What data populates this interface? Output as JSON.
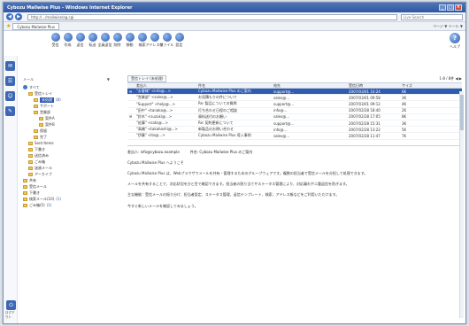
{
  "window": {
    "title": "Cybozu Mailwise Plus - Windows Internet Explorer",
    "controls": [
      "_",
      "□",
      "×"
    ]
  },
  "browser": {
    "address": "http://.../mailwise/ag.cgi",
    "search_placeholder": "Live Search",
    "tab_label": "Cybozu Mailwise Plus",
    "tools": "ページ ▼  ツール ▼"
  },
  "toolbar": {
    "items": [
      "受信",
      "作成",
      "返信",
      "転送",
      "全員返信",
      "削除",
      "移動",
      "検索",
      "アドレス帳",
      "ファイル",
      "設定"
    ],
    "help": "ヘルプ"
  },
  "sidebar": {
    "bottom_label": "ログアウト"
  },
  "tree": {
    "header_left": "メール",
    "header_right": "▼",
    "nodes": [
      {
        "label": "すべて",
        "kind": "globe",
        "indent": 0
      },
      {
        "label": "受信トレイ",
        "kind": "folder",
        "indent": 1
      },
      {
        "label": "未処理",
        "kind": "folder",
        "indent": 2,
        "selected": true,
        "count": "(8)"
      },
      {
        "label": "サポート",
        "kind": "folder",
        "indent": 2
      },
      {
        "label": "営業部",
        "kind": "folder",
        "indent": 2
      },
      {
        "label": "案件A",
        "kind": "folder",
        "indent": 3
      },
      {
        "label": "案件B",
        "kind": "folder",
        "indent": 3
      },
      {
        "label": "保留",
        "kind": "folder",
        "indent": 2
      },
      {
        "label": "完了",
        "kind": "folder",
        "indent": 2
      },
      {
        "label": "Sent Items",
        "kind": "folder",
        "indent": 1
      },
      {
        "label": "下書き",
        "kind": "folder",
        "indent": 1
      },
      {
        "label": "送信済み",
        "kind": "folder",
        "indent": 1
      },
      {
        "label": "ごみ箱",
        "kind": "folder",
        "indent": 1
      },
      {
        "label": "迷惑メール",
        "kind": "folder",
        "indent": 1
      },
      {
        "label": "アーカイブ",
        "kind": "folder",
        "indent": 1
      },
      {
        "label": "共有",
        "kind": "folder",
        "indent": 0
      },
      {
        "label": "受信メール",
        "kind": "folder",
        "indent": 0
      },
      {
        "label": "下書き",
        "kind": "folder",
        "indent": 0
      },
      {
        "label": "検索メール(10)",
        "kind": "folder",
        "indent": 0,
        "count": "(1)"
      },
      {
        "label": "ごみ箱(5)",
        "kind": "folder",
        "indent": 0,
        "count": "(1)"
      }
    ]
  },
  "list": {
    "folder_label": "受信トレイ (未処理)",
    "pager": "1-8 / 8件 ◀ ▶",
    "columns": [
      "",
      "差出人",
      "件名",
      "宛先",
      "受信日時",
      "サイズ",
      ""
    ],
    "rows": [
      {
        "mark": "✉",
        "from": "\"お客様\" <info@...>",
        "subject": "Cybozu Mailwise Plus のご案内",
        "to": "support@...",
        "date": "2007/03/01 10:24",
        "size": "6K",
        "selected": true
      },
      {
        "mark": "",
        "from": "\"営業部\" <sales@...>",
        "subject": "お見積もりの件について",
        "to": "sales@...",
        "date": "2007/03/01 09:58",
        "size": "3K"
      },
      {
        "mark": "",
        "from": "\"Support\" <help@...>",
        "subject": "Re: 製品についての質問",
        "to": "support@...",
        "date": "2007/03/01 09:12",
        "size": "4K"
      },
      {
        "mark": "",
        "from": "\"田中\" <tanaka@...>",
        "subject": "打ち合わせ日程のご相談",
        "to": "info@...",
        "date": "2007/02/28 18:40",
        "size": "2K"
      },
      {
        "mark": "✉",
        "from": "\"鈴木\" <suzuki@...>",
        "subject": "資料送付のお願い",
        "to": "sales@...",
        "date": "2007/02/28 17:05",
        "size": "8K"
      },
      {
        "mark": "",
        "from": "\"佐藤\" <sato@...>",
        "subject": "Re: 契約更新について",
        "to": "support@...",
        "date": "2007/02/28 15:31",
        "size": "3K"
      },
      {
        "mark": "",
        "from": "\"高橋\" <takahashi@...>",
        "subject": "新製品のお問い合わせ",
        "to": "info@...",
        "date": "2007/02/28 13:22",
        "size": "5K"
      },
      {
        "mark": "",
        "from": "\"伊藤\" <ito@...>",
        "subject": "Cybozu Mailwise Plus 導入事例",
        "to": "sales@...",
        "date": "2007/02/28 11:47",
        "size": "7K"
      }
    ]
  },
  "preview": {
    "from_label": "差出人: info@cybozu.example",
    "subject_label": "件名: Cybozu Mailwise Plus のご案内",
    "greeting": "Cybozu Mailwise Plus へようこそ",
    "paragraphs": [
      "Cybozu Mailwise Plus は、Webブラウザでメールを共有・管理するためのグループウェアです。複数の担当者で受信メールを分担して処理できます。",
      "メールを共有することで、対応状況をひと目で確認できます。担当者の割り当てやステータス管理により、対応漏れや二重返信を防ぎます。",
      "主な機能：受信メールの振り分け、担当者設定、ステータス管理、返信テンプレート、検索、アドレス帳などをご利用いただけます。",
      "今すぐ新しいメールを確認してみましょう。"
    ]
  }
}
